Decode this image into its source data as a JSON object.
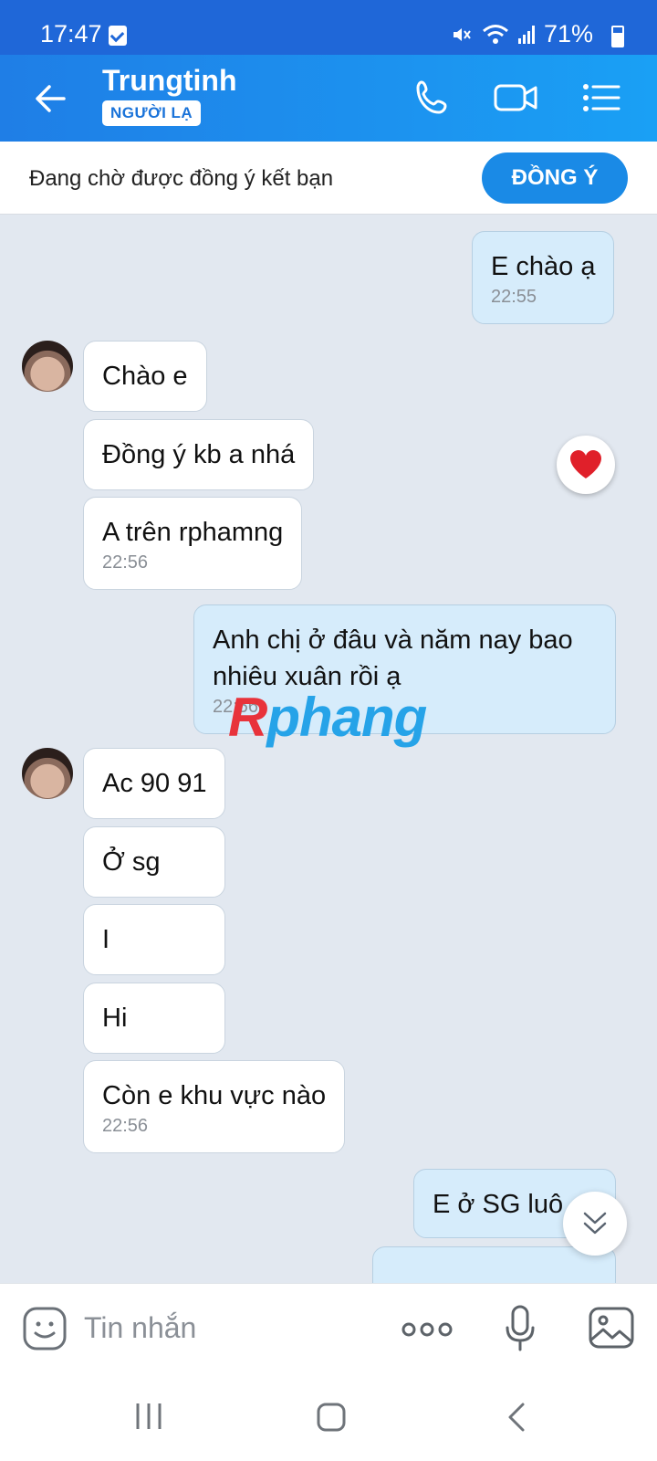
{
  "status_bar": {
    "time": "17:47",
    "battery": "71%"
  },
  "header": {
    "contact_name": "Trungtinh",
    "badge": "NGƯỜI LẠ"
  },
  "friend_request": {
    "message": "Đang chờ được đồng ý kết bạn",
    "button": "ĐỒNG Ý"
  },
  "messages": [
    {
      "side": "sent",
      "text": "E chào ạ",
      "time": "22:55"
    },
    {
      "side": "received",
      "text": "Chào e"
    },
    {
      "side": "received",
      "text": "Đồng ý kb a nhá",
      "reaction": "heart"
    },
    {
      "side": "received",
      "text": "A trên rphamng",
      "time": "22:56"
    },
    {
      "side": "sent",
      "text": "Anh chị ở đâu và năm nay bao nhiêu xuân rồi ạ",
      "time": "22:56"
    },
    {
      "side": "received",
      "text": "Ac 90 91"
    },
    {
      "side": "received",
      "text": "Ở sg"
    },
    {
      "side": "received",
      "text": "I"
    },
    {
      "side": "received",
      "text": "Hi"
    },
    {
      "side": "received",
      "text": "Còn e khu vực nào",
      "time": "22:56"
    },
    {
      "side": "sent",
      "text": "E ở SG luô"
    }
  ],
  "watermark": {
    "first": "R",
    "rest": "phang"
  },
  "composer": {
    "placeholder": "Tin nhắn"
  }
}
